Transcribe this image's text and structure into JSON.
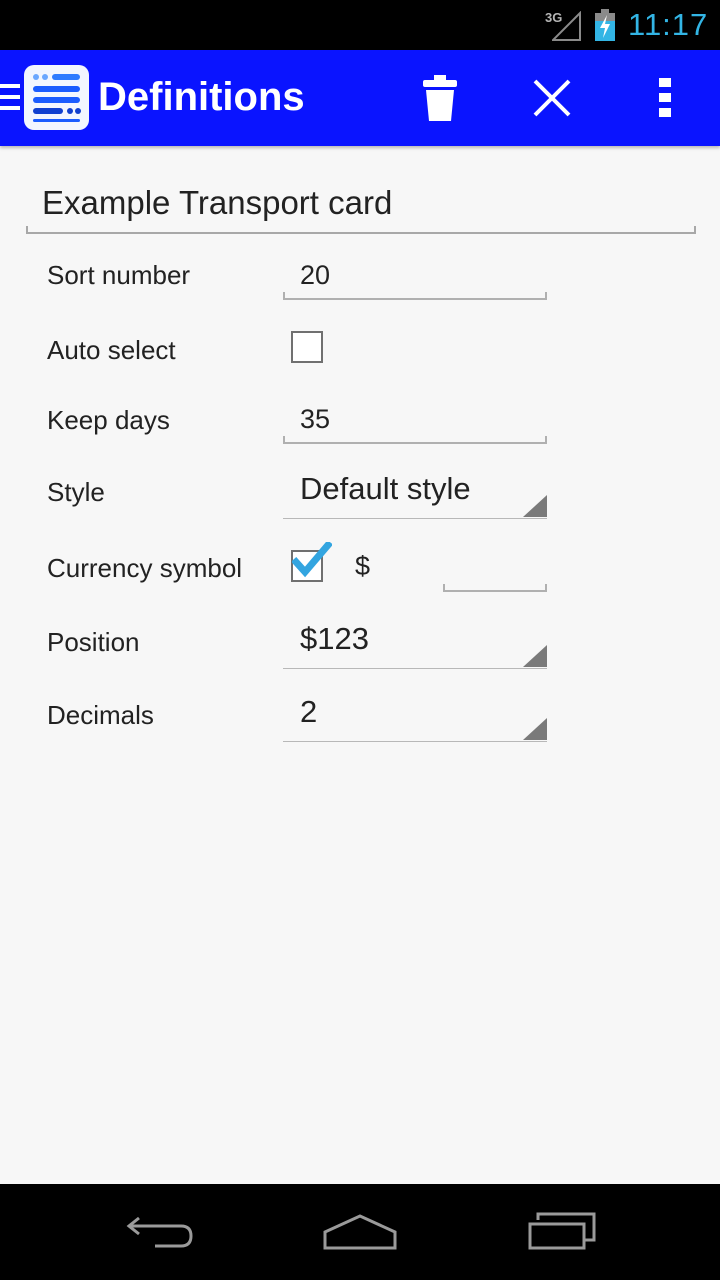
{
  "status_bar": {
    "network": "3G",
    "time": "11:17"
  },
  "action_bar": {
    "title": "Definitions"
  },
  "form": {
    "name_value": "Example Transport card",
    "sort_number": {
      "label": "Sort number",
      "value": "20"
    },
    "auto_select": {
      "label": "Auto select",
      "checked": false
    },
    "keep_days": {
      "label": "Keep days",
      "value": "35"
    },
    "style": {
      "label": "Style",
      "selected": "Default style"
    },
    "currency_symbol": {
      "label": "Currency symbol",
      "checked": true,
      "symbol": "$",
      "field_value": ""
    },
    "position": {
      "label": "Position",
      "selected": "$123"
    },
    "decimals": {
      "label": "Decimals",
      "selected": "2"
    }
  },
  "colors": {
    "action_bar": "#0a14ff",
    "accent": "#33b5e5",
    "background": "#f7f7f7"
  },
  "icons": [
    "menu-icon",
    "app-logo-icon",
    "delete-icon",
    "close-icon",
    "overflow-menu-icon",
    "back-icon",
    "home-icon",
    "recents-icon"
  ]
}
